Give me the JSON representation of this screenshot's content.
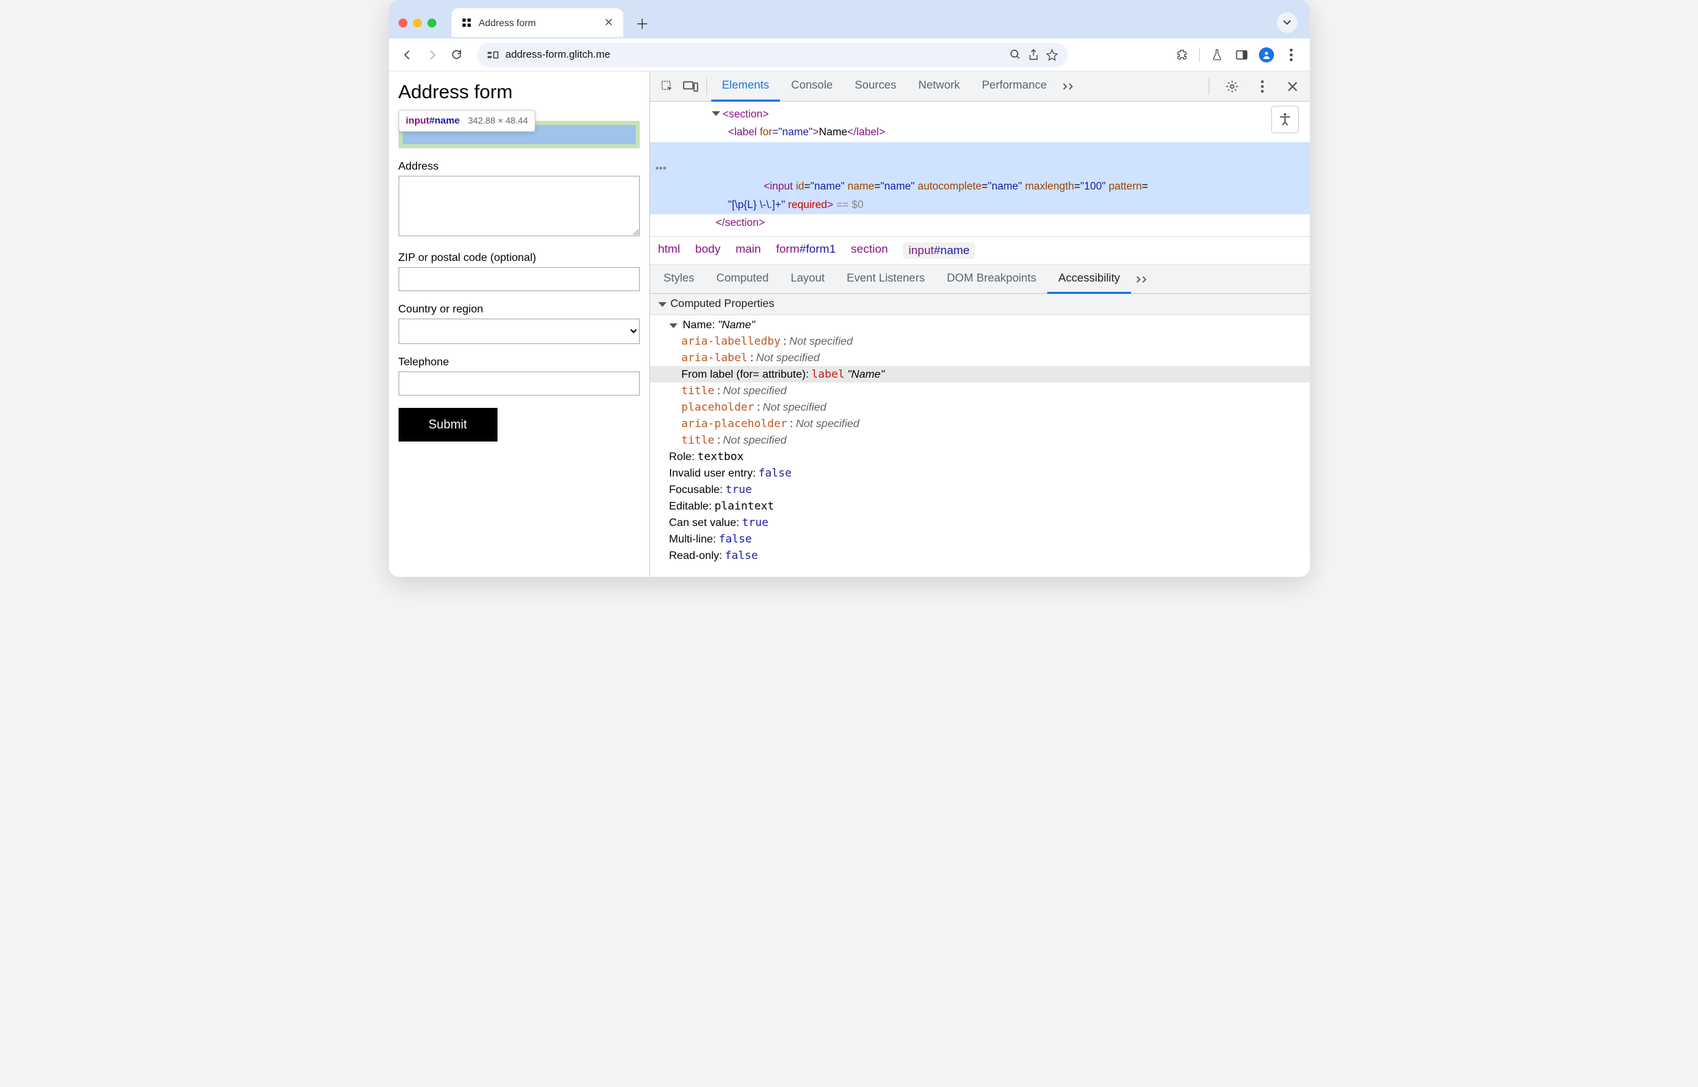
{
  "window": {
    "tab_title": "Address form",
    "url": "address-form.glitch.me"
  },
  "page": {
    "heading": "Address form",
    "tooltip": {
      "tag": "input",
      "id": "#name",
      "dims": "342.88 × 48.44"
    },
    "labels": {
      "address": "Address",
      "zip": "ZIP or postal code (optional)",
      "country": "Country or region",
      "telephone": "Telephone"
    },
    "submit": "Submit"
  },
  "devtools": {
    "tabs": [
      "Elements",
      "Console",
      "Sources",
      "Network",
      "Performance"
    ],
    "active_tab": "Elements",
    "dom": {
      "line1": {
        "open": "<",
        "tag": "section",
        "close": ">"
      },
      "line2": {
        "open": "<",
        "tag": "label",
        "attr1n": " for",
        "attr1v": "=\"name\"",
        "close1": ">",
        "text": "Name",
        "open2": "</",
        "close2": ">"
      },
      "line3_open": "<",
      "line3_tag": "input",
      "line3_attrs": " id=\"name\" name=\"name\" autocomplete=\"name\" maxlength=\"100\" pattern=",
      "line3b": "\"[\\p{L} \\-\\.]+\" ",
      "line3_req": "required",
      "line3_close": ">",
      "line3_tail": " == $0",
      "line4": {
        "open": "</",
        "tag": "section",
        "close": ">"
      }
    },
    "breadcrumbs": [
      {
        "text": "html"
      },
      {
        "text": "body"
      },
      {
        "text": "main"
      },
      {
        "text": "form",
        "id": "#form1"
      },
      {
        "text": "section"
      },
      {
        "text": "input",
        "id": "#name",
        "active": true
      }
    ],
    "sub_tabs": [
      "Styles",
      "Computed",
      "Layout",
      "Event Listeners",
      "DOM Breakpoints",
      "Accessibility"
    ],
    "active_sub_tab": "Accessibility",
    "a11y": {
      "section": "Computed Properties",
      "name_label": "Name: ",
      "name_value": "\"Name\"",
      "sources": [
        {
          "key": "aria-labelledby",
          "sep": ": ",
          "val": "Not specified",
          "type": "ns"
        },
        {
          "key": "aria-label",
          "sep": ": ",
          "val": "Not specified",
          "type": "ns"
        },
        {
          "label": "From label (for= attribute): ",
          "kw": "label",
          "val": " \"Name\"",
          "type": "hl"
        },
        {
          "key": "title",
          "sep": ": ",
          "val": "Not specified",
          "type": "ns"
        },
        {
          "key": "placeholder",
          "sep": ": ",
          "val": "Not specified",
          "type": "ns"
        },
        {
          "key": "aria-placeholder",
          "sep": ": ",
          "val": "Not specified",
          "type": "ns"
        },
        {
          "key": "title",
          "sep": ": ",
          "val": "Not specified",
          "type": "ns"
        }
      ],
      "props": [
        {
          "k": "Role: ",
          "v": "textbox",
          "cls": "blackv mono"
        },
        {
          "k": "Invalid user entry: ",
          "v": "false",
          "cls": "navy mono"
        },
        {
          "k": "Focusable: ",
          "v": "true",
          "cls": "navy mono"
        },
        {
          "k": "Editable: ",
          "v": "plaintext",
          "cls": "blackv mono"
        },
        {
          "k": "Can set value: ",
          "v": "true",
          "cls": "navy mono"
        },
        {
          "k": "Multi-line: ",
          "v": "false",
          "cls": "navy mono"
        },
        {
          "k": "Read-only: ",
          "v": "false",
          "cls": "navy mono"
        }
      ]
    }
  }
}
